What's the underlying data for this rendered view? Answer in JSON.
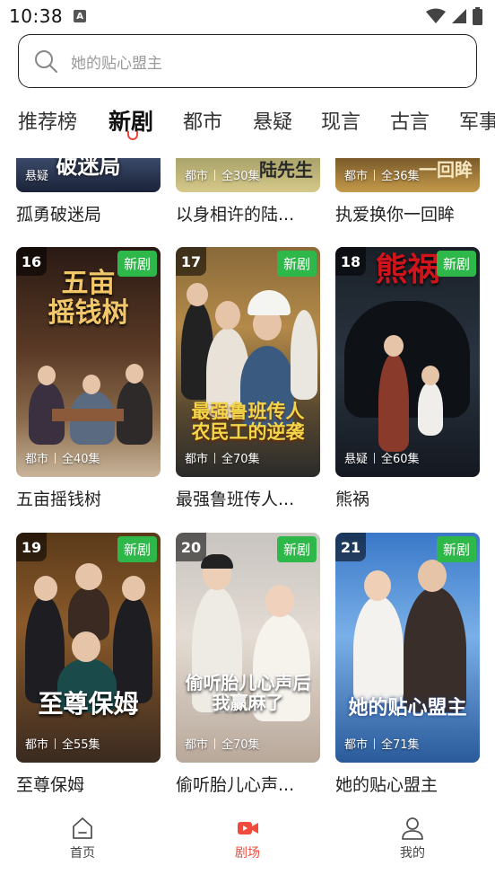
{
  "status_bar": {
    "time": "10:38",
    "notification_icon": "A"
  },
  "search": {
    "placeholder": "她的贴心盟主"
  },
  "tabs": [
    {
      "label": "推荐榜"
    },
    {
      "label": "新剧",
      "active": true
    },
    {
      "label": "都市"
    },
    {
      "label": "悬疑"
    },
    {
      "label": "现言"
    },
    {
      "label": "古言"
    },
    {
      "label": "军事"
    }
  ],
  "top_row": [
    {
      "title": "孤勇破迷局",
      "genre": "悬疑",
      "episodes": "",
      "art_text": "破迷局"
    },
    {
      "title": "以身相许的陆...",
      "genre": "都市",
      "episodes": "全30集",
      "art_text": "陆先生"
    },
    {
      "title": "执爱换你一回眸",
      "genre": "都市",
      "episodes": "全36集",
      "art_text": "一回眸"
    }
  ],
  "dramas": [
    {
      "rank": "16",
      "badge": "新剧",
      "title": "五亩摇钱树",
      "genre": "都市",
      "episodes": "全40集",
      "art_text": "五亩\n摇钱树"
    },
    {
      "rank": "17",
      "badge": "新剧",
      "title": "最强鲁班传人...",
      "genre": "都市",
      "episodes": "全70集",
      "art_text": "最强鲁班传人\n农民工的逆袭"
    },
    {
      "rank": "18",
      "badge": "新剧",
      "title": "熊祸",
      "genre": "悬疑",
      "episodes": "全60集",
      "art_text": "熊祸"
    },
    {
      "rank": "19",
      "badge": "新剧",
      "title": "至尊保姆",
      "genre": "都市",
      "episodes": "全55集",
      "art_text": "至尊保姆"
    },
    {
      "rank": "20",
      "badge": "新剧",
      "title": "偷听胎儿心声...",
      "genre": "都市",
      "episodes": "全70集",
      "art_text": "偷听胎儿心声后\n我赢麻了"
    },
    {
      "rank": "21",
      "badge": "新剧",
      "title": "她的贴心盟主",
      "genre": "都市",
      "episodes": "全71集",
      "art_text": "她的贴心盟主"
    }
  ],
  "bottom_nav": [
    {
      "label": "首页",
      "icon": "home-icon"
    },
    {
      "label": "剧场",
      "icon": "video-camera-icon",
      "active": true
    },
    {
      "label": "我的",
      "icon": "user-icon"
    }
  ],
  "colors": {
    "accent": "#ef4c3d",
    "badge_green": "#2fb84a"
  }
}
